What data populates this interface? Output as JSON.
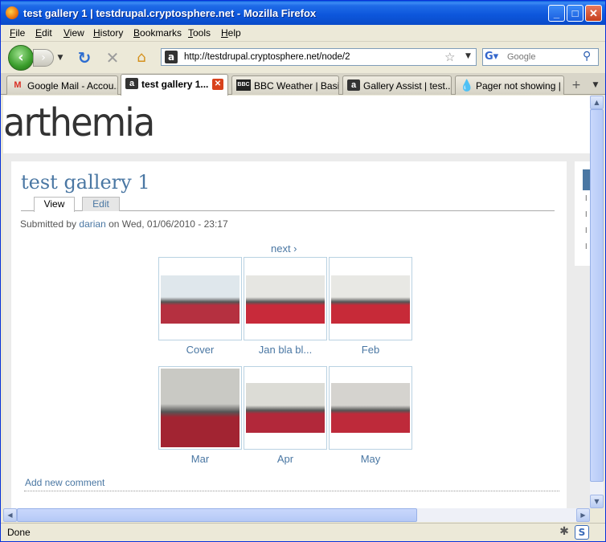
{
  "window": {
    "title": "test gallery 1 | testdrupal.cryptosphere.net - Mozilla Firefox"
  },
  "menubar": {
    "items": [
      "File",
      "Edit",
      "View",
      "History",
      "Bookmarks",
      "Tools",
      "Help"
    ]
  },
  "navbar": {
    "url": "http://testdrupal.cryptosphere.net/node/2",
    "search_placeholder": "Google"
  },
  "tabs": [
    {
      "label": "Google Mail - Accou...",
      "icon": "gmail-icon",
      "active": false
    },
    {
      "label": "test gallery 1...",
      "icon": "site-a-icon",
      "active": true
    },
    {
      "label": "BBC Weather | Basi...",
      "icon": "bbc-icon",
      "active": false
    },
    {
      "label": "Gallery Assist | test...",
      "icon": "site-a-icon",
      "active": false
    },
    {
      "label": "Pager not showing | ...",
      "icon": "drupal-icon",
      "active": false
    }
  ],
  "site": {
    "name": "arthemia"
  },
  "node": {
    "title": "test gallery 1",
    "tabs": {
      "view": "View",
      "edit": "Edit"
    },
    "submitted_prefix": "Submitted by",
    "author": "darian",
    "submitted_suffix": "on Wed, 01/06/2010 - 23:17",
    "pager_next": "next ›",
    "add_comment": "Add new comment"
  },
  "gallery": [
    {
      "label": "Cover",
      "color_top": "#dfe7ec",
      "color_bottom": "#b53040"
    },
    {
      "label": "Jan bla bl...",
      "color_top": "#e6e6e2",
      "color_bottom": "#c82a3a"
    },
    {
      "label": "Feb",
      "color_top": "#e8e8e4",
      "color_bottom": "#c72a38"
    },
    {
      "label": "Mar",
      "color_top": "#c9c9c4",
      "color_bottom": "#a22432"
    },
    {
      "label": "Apr",
      "color_top": "#dcdcd6",
      "color_bottom": "#b2283a"
    },
    {
      "label": "May",
      "color_top": "#d5d3cf",
      "color_bottom": "#be2a3a"
    }
  ],
  "status": {
    "text": "Done"
  }
}
